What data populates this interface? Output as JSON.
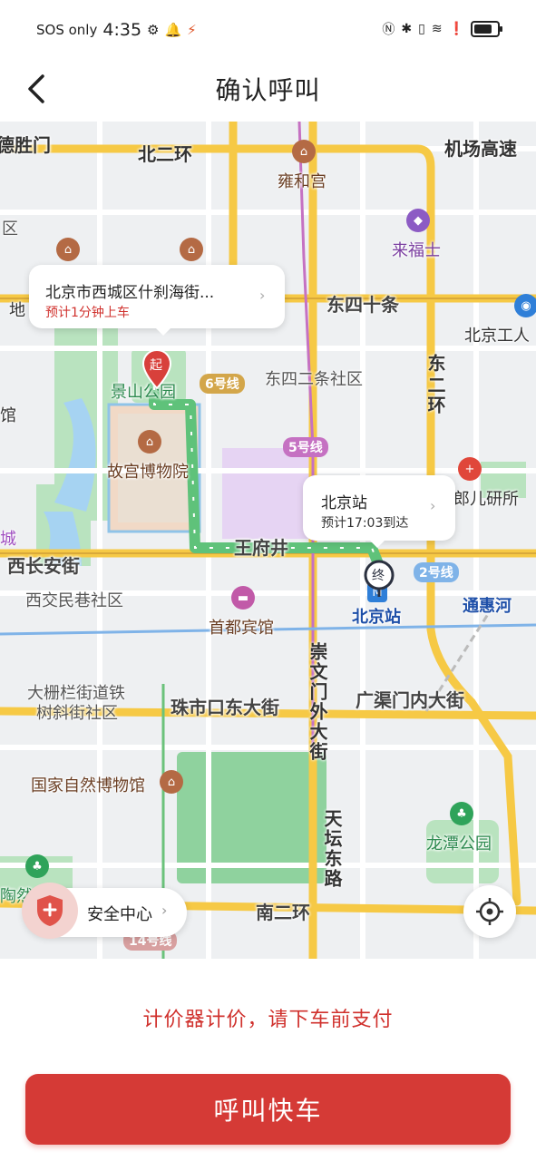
{
  "status_bar": {
    "carrier": "SOS only",
    "time": "4:35",
    "icons": [
      "gear-icon",
      "bell-icon",
      "runner-icon",
      "nfc-icon",
      "bluetooth-icon",
      "vibrate-icon",
      "wifi-icon",
      "alert-icon",
      "battery-icon"
    ]
  },
  "header": {
    "title": "确认呼叫"
  },
  "map": {
    "labels": {
      "deshengmen": "德胜门",
      "beierhuan": "北二环",
      "jichang": "机场高速",
      "yonghegong": "雍和宫",
      "laifushi": "来福士",
      "dongsishitiao": "东四十条",
      "beijinggongren": "北京工人",
      "dong": "东",
      "erhuan": "二环",
      "dongsiertiao": "东四二条社区",
      "jingshan": "景山公园",
      "gugong": "故宫博物院",
      "erliyansuo": "郎儿研所",
      "wangfujing": "王府井",
      "xichanganjie": "西长安街",
      "xijiaominxiang": "西交民巷社区",
      "shoudubinguan": "首都宾馆",
      "beijingzhan": "北京站",
      "tonghuihe": "通惠河",
      "chongwenmenwaidajie": "崇文门外大街",
      "guangqumenneidajie": "广渠门内大街",
      "zhushikou": "珠市口东大街",
      "dashilan": "大栅栏街道铁",
      "shuxiejie": "树斜街社区",
      "ziranbowuguan": "国家自然博物馆",
      "tiantandonglu": "天坛东路",
      "longtan": "龙潭公园",
      "nanerhuan": "南二环",
      "di": "地",
      "guan": "馆",
      "qu": "区",
      "cheng": "城",
      "ranxi": "陶然",
      "line6": "6号线",
      "line5": "5号线",
      "line2": "2号线",
      "line14": "14号线"
    },
    "pickup": {
      "address": "北京市西城区什刹海街...",
      "eta": "预计1分钟上车",
      "marker": "起"
    },
    "destination": {
      "name": "北京站",
      "eta": "预计17:03到达",
      "marker": "终"
    },
    "safety_center": "安全中心"
  },
  "notice": "计价器计价，请下车前支付",
  "call_button": "呼叫快车",
  "colors": {
    "brand_red": "#d53a36",
    "route_green": "#5fc27a",
    "road_yellow": "#f6c945",
    "park_green": "#b9e3bf"
  }
}
